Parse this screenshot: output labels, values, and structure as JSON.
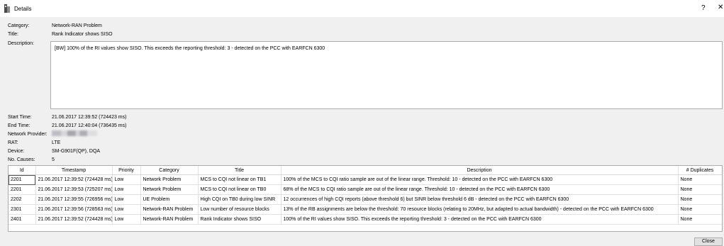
{
  "window": {
    "title": "Details",
    "help_glyph": "?",
    "close_glyph": "✕"
  },
  "fields": {
    "category_label": "Category:",
    "category_value": "Network-RAN Problem",
    "title_label": "Title:",
    "title_value": "Rank Indicator shows SISO",
    "description_label": "Description:",
    "description_value": "[BW] 100% of the RI values show SISO. This exceeds the reporting threshold: 3 - detected on the PCC with EARFCN 6300",
    "start_time_label": "Start Time:",
    "start_time_value": "21.06.2017 12:39:52 (724423 ms)",
    "end_time_label": "End Time:",
    "end_time_value": "21.06.2017 12:40:04 (736435 ms)",
    "network_provider_label": "Network Provider:",
    "rat_label": "RAT:",
    "rat_value": "LTE",
    "device_label": "Device:",
    "device_value": "SM-G901F(QP), DQA",
    "no_causes_label": "No. Causes:",
    "no_causes_value": "5"
  },
  "table": {
    "columns": [
      "Id",
      "Timestamp",
      "Priority",
      "Category",
      "Title",
      "Description",
      "# Duplicates"
    ],
    "rows": [
      [
        "2201",
        "21.06.2017 12:39:52 (724428 ms)",
        "Low",
        "Network Problem",
        "MCS to CQI not linear on TB1",
        "100% of the MCS to CQI ratio sample are out of the linear range. Threshold: 10 - detected on the PCC with EARFCN 6300",
        "None"
      ],
      [
        "2201",
        "21.06.2017 12:39:53 (725207 ms)",
        "Low",
        "Network Problem",
        "MCS to CQI not linear on TB0",
        "68% of the MCS to CQI ratio sample are out of the linear range. Threshold: 10 - detected on the PCC with EARFCN 6300",
        "None"
      ],
      [
        "2202",
        "21.06.2017 12:39:55 (726956 ms)",
        "Low",
        "UE Problem",
        "High CQI on TB0 during low SINR",
        "12 occurrences of high CQI reports (above threshold 6) but SINR below threshold 6 dB - detected on the PCC with EARFCN 6300",
        "None"
      ],
      [
        "2301",
        "21.06.2017 12:39:56 (728563 ms)",
        "Low",
        "Network-RAN Problem",
        "Low number of resource blocks",
        "13% of the RB assignments are below the threshold: 70 resource blocks (relating to 20MHz, but adapted to actual bandwidth) - detected on the PCC with EARFCN 6300",
        "None"
      ],
      [
        "2401",
        "21.06.2017 12:39:52 (724428 ms)",
        "Low",
        "Network-RAN Problem",
        "Rank Indicator shows SISO",
        "100% of the RI values show SISO. This exceeds the reporting threshold: 3 - detected on the PCC with EARFCN 6300",
        "None"
      ]
    ]
  },
  "buttons": {
    "close": "Close"
  }
}
